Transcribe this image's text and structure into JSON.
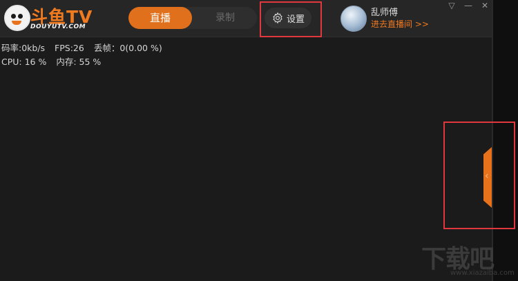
{
  "app": {
    "brand_name": "斗鱼TV",
    "brand_domain": "DOUYUTV.COM"
  },
  "tabs": {
    "live_label": "直播",
    "record_label": "录制"
  },
  "settings": {
    "label": "设置",
    "icon": "gear-icon"
  },
  "user": {
    "name": "乱师傅",
    "enter_room": "进去直播间 >>"
  },
  "window_controls": {
    "menu_icon": "▽",
    "minimize_icon": "—",
    "close_icon": "✕"
  },
  "stats": {
    "bitrate": "码率:0kb/s",
    "fps": "FPS:26",
    "dropped": "丢帧：0(0.00 %)",
    "cpu": "CPU: 16 %",
    "memory": "内存: 55 %"
  },
  "side_panel": {
    "chevron": "‹"
  },
  "watermark": {
    "main": "下载吧",
    "sub": "www.xiazaiba.com"
  },
  "colors": {
    "accent": "#e0701b",
    "highlight_box": "#e0383c",
    "background": "#1b1b1b"
  }
}
